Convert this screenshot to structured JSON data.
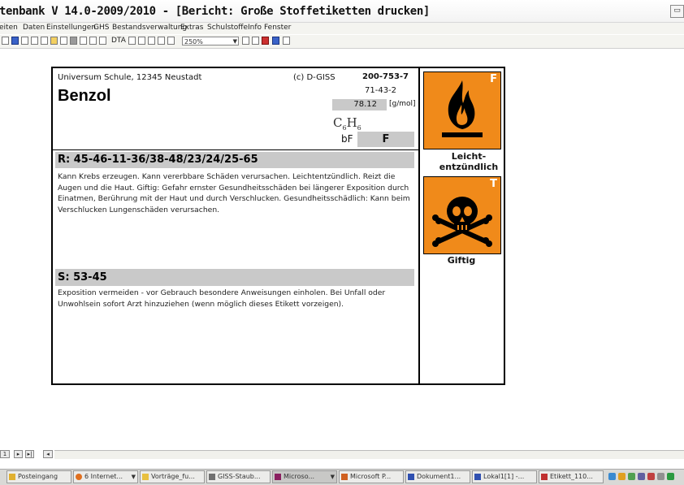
{
  "window": {
    "title": "tenbank V 14.0-2009/2010 - [Bericht: Große Stoffetiketten drucken]",
    "close_glyph": "▭"
  },
  "menu": [
    "eiten",
    "Daten",
    "Einstellungen",
    "GHS",
    "Bestandsverwaltung",
    "Extras",
    "Schulstoffe",
    "Info",
    "Fenster"
  ],
  "toolbar": {
    "dta_label": "DTA",
    "zoom_value": "250%"
  },
  "label": {
    "school": "Universum Schule, 12345 Neustadt",
    "copyright": "(c) D-GISS",
    "code": "200-753-7",
    "cas": "71-43-2",
    "substance": "Benzol",
    "molar_mass": "78.12",
    "molar_mass_unit": "[g/mol]",
    "formula_c": "C",
    "formula_c_sub": "6",
    "formula_h": "H",
    "formula_h_sub": "6",
    "class_short": "bF",
    "class_code": "F",
    "r_header": "R: 45-46-11-36/38-48/23/24/25-65",
    "r_text": "Kann Krebs erzeugen. Kann vererbbare Schäden verursachen. Leichtentzündlich. Reizt die Augen und die Haut. Giftig: Gefahr ernster Gesundheitsschäden bei längerer Exposition durch Einatmen, Berührung mit der Haut und durch Verschlucken. Gesundheitsschädlich: Kann beim Verschlucken Lungenschäden verursachen.",
    "s_header": "S: 53-45",
    "s_text": "Exposition vermeiden - vor Gebrauch besondere Anweisungen einholen. Bei Unfall oder Unwohlsein sofort Arzt hinzuziehen (wenn möglich dieses Etikett vorzeigen)."
  },
  "hazards": [
    {
      "letter": "F",
      "icon": "flame-icon",
      "caption_line1": "Leicht-",
      "caption_line2": "entzündlich",
      "color": "#f08a1a"
    },
    {
      "letter": "T",
      "icon": "skull-crossbones-icon",
      "caption": "Giftig",
      "color": "#f08a1a"
    }
  ],
  "pagenav": {
    "page": "1"
  },
  "taskbar": {
    "items": [
      "Posteingang",
      "6 Internet...",
      "Vorträge_fu...",
      "GISS-Staub...",
      "Microso...",
      "Microsoft P...",
      "Dokument1...",
      "Lokal1[1] -...",
      "Etikett_110..."
    ]
  }
}
